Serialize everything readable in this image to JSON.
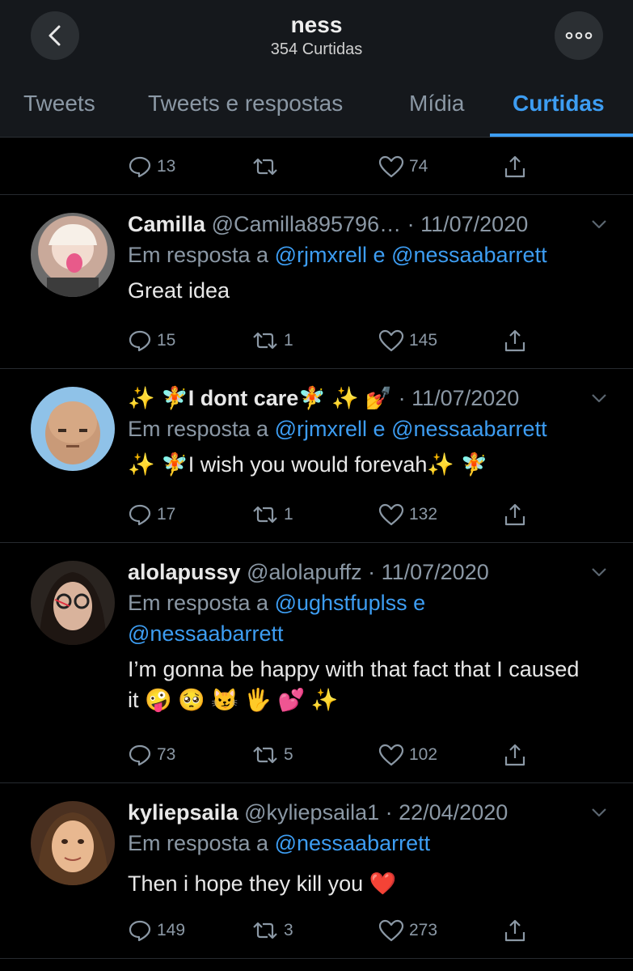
{
  "header": {
    "title": "ness",
    "subtitle": "354 Curtidas"
  },
  "tabs": [
    {
      "label": "Tweets"
    },
    {
      "label": "Tweets e respostas"
    },
    {
      "label": "Mídia"
    },
    {
      "label": "Curtidas"
    }
  ],
  "top_partial": {
    "replies": "13",
    "retweets": "",
    "likes": "74"
  },
  "tweets": [
    {
      "name": "Camilla",
      "handle": "@Camilla895796…",
      "date": "· 11/07/2020",
      "reply_prefix": "Em resposta a",
      "mention1": "@rjmxrell",
      "conj": "e",
      "mention2": "@nessaabarrett",
      "text": "Great idea",
      "replies": "15",
      "retweets": "1",
      "likes": "145"
    },
    {
      "name": "✨ 🧚I dont care🧚 ✨ 💅",
      "handle": "",
      "date": "· 11/07/2020",
      "reply_prefix": "Em resposta a",
      "mention1": "@rjmxrell",
      "conj": "e",
      "mention2": "@nessaabarrett",
      "text": "✨ 🧚I wish you would forevah✨ 🧚",
      "replies": "17",
      "retweets": "1",
      "likes": "132"
    },
    {
      "name": "alolapussy",
      "handle": "@alolapuffz",
      "date": "· 11/07/2020",
      "reply_prefix": "Em resposta a",
      "mention1": "@ughstfuplss",
      "conj": "e",
      "mention2": "@nessaabarrett",
      "text": "I’m gonna be happy with that fact that I caused it 🤪 🥺 😼 🖐 💕 ✨",
      "replies": "73",
      "retweets": "5",
      "likes": "102"
    },
    {
      "name": "kyliepsaila",
      "handle": "@kyliepsaila1",
      "date": "· 22/04/2020",
      "reply_prefix": "Em resposta a",
      "mention1": "@nessaabarrett",
      "text": "Then i hope they kill you ❤️",
      "replies": "149",
      "retweets": "3",
      "likes": "273"
    }
  ],
  "colors": {
    "accent": "#3d9df2",
    "muted": "#8b98a5",
    "header_bg": "#15181c"
  },
  "icons": [
    "back-arrow-icon",
    "more-dots-icon",
    "reply-icon",
    "retweet-icon",
    "like-heart-icon",
    "share-icon",
    "chevron-down-icon"
  ]
}
